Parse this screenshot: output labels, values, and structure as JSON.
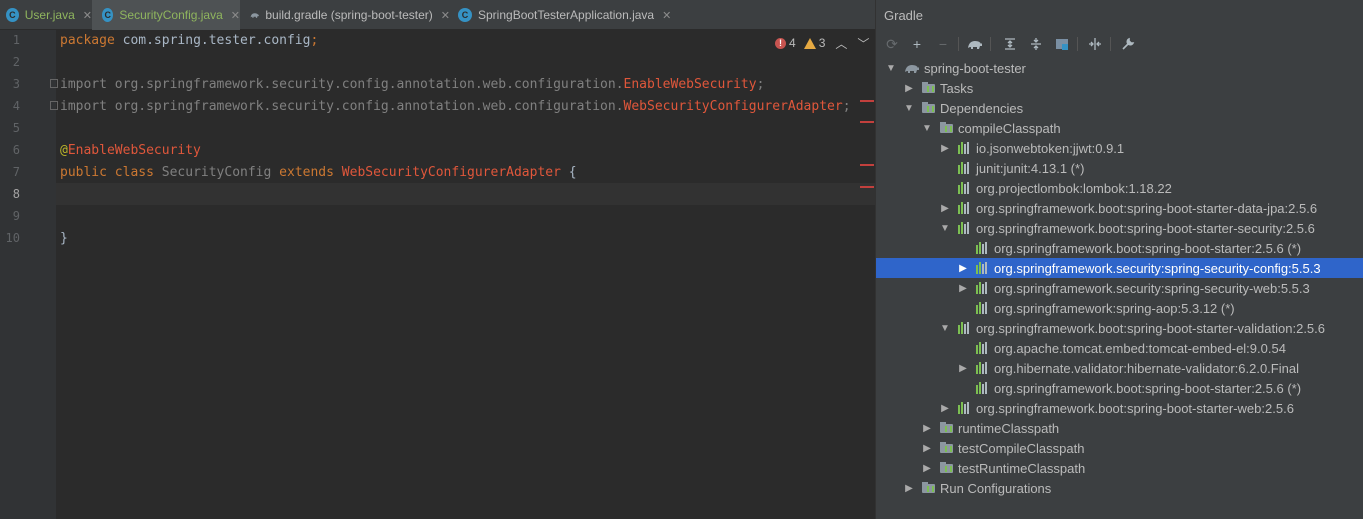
{
  "tabs": [
    {
      "label": "User.java",
      "icon": "java-class-icon"
    },
    {
      "label": "SecurityConfig.java",
      "icon": "java-class-icon",
      "active": true
    },
    {
      "label": "build.gradle (spring-boot-tester)",
      "icon": "gradle-elephant-icon"
    },
    {
      "label": "SpringBootTesterApplication.java",
      "icon": "spring-app-icon"
    }
  ],
  "editor": {
    "line_numbers": [
      "1",
      "2",
      "3",
      "4",
      "5",
      "6",
      "7",
      "8",
      "9",
      "10"
    ],
    "current_line": "8",
    "inspections": {
      "errors": "4",
      "warnings": "3"
    },
    "code": {
      "l1_kw": "package",
      "l1_rest": " com.spring.tester.config",
      "l1_semi": ";",
      "l3_kw": "import",
      "l3_pkg": " org.springframework.security.config.annotation.web.configuration.",
      "l3_cls": "EnableWebSecurity",
      "l3_semi": ";",
      "l4_kw": "import",
      "l4_pkg": " org.springframework.security.config.annotation.web.configuration.",
      "l4_cls": "WebSecurityConfigurerAdapter",
      "l4_semi": ";",
      "l6_at": "@",
      "l6_ann": "EnableWebSecurity",
      "l7_kw1": "public",
      "l7_kw2": "class",
      "l7_name": "SecurityConfig",
      "l7_kw3": "extends",
      "l7_parent": "WebSecurityConfigurerAdapter",
      "l7_brace": " {",
      "l10_brace": "}"
    }
  },
  "gradle": {
    "title": "Gradle",
    "toolbar": [
      "reload-icon",
      "add-icon",
      "remove-icon",
      "elephant-icon",
      "expand-all-icon",
      "collapse-all-icon",
      "group-modules-icon",
      "toggle-offline-icon",
      "settings-wrench-icon"
    ],
    "tree": [
      {
        "label": "spring-boot-tester",
        "indent": 0,
        "arrow": "down",
        "icon": "project"
      },
      {
        "label": "Tasks",
        "indent": 1,
        "arrow": "right",
        "icon": "folder"
      },
      {
        "label": "Dependencies",
        "indent": 1,
        "arrow": "down",
        "icon": "folder"
      },
      {
        "label": "compileClasspath",
        "indent": 2,
        "arrow": "down",
        "icon": "folder"
      },
      {
        "label": "io.jsonwebtoken:jjwt:0.9.1",
        "indent": 3,
        "arrow": "right",
        "icon": "dep"
      },
      {
        "label": "junit:junit:4.13.1 (*)",
        "indent": 3,
        "arrow": "",
        "icon": "dep"
      },
      {
        "label": "org.projectlombok:lombok:1.18.22",
        "indent": 3,
        "arrow": "",
        "icon": "dep"
      },
      {
        "label": "org.springframework.boot:spring-boot-starter-data-jpa:2.5.6",
        "indent": 3,
        "arrow": "right",
        "icon": "dep"
      },
      {
        "label": "org.springframework.boot:spring-boot-starter-security:2.5.6",
        "indent": 3,
        "arrow": "down",
        "icon": "dep"
      },
      {
        "label": "org.springframework.boot:spring-boot-starter:2.5.6 (*)",
        "indent": 4,
        "arrow": "",
        "icon": "dep"
      },
      {
        "label": "org.springframework.security:spring-security-config:5.5.3",
        "indent": 4,
        "arrow": "right",
        "icon": "dep",
        "selected": true
      },
      {
        "label": "org.springframework.security:spring-security-web:5.5.3",
        "indent": 4,
        "arrow": "right",
        "icon": "dep"
      },
      {
        "label": "org.springframework:spring-aop:5.3.12 (*)",
        "indent": 4,
        "arrow": "",
        "icon": "dep"
      },
      {
        "label": "org.springframework.boot:spring-boot-starter-validation:2.5.6",
        "indent": 3,
        "arrow": "down",
        "icon": "dep"
      },
      {
        "label": "org.apache.tomcat.embed:tomcat-embed-el:9.0.54",
        "indent": 4,
        "arrow": "",
        "icon": "dep"
      },
      {
        "label": "org.hibernate.validator:hibernate-validator:6.2.0.Final",
        "indent": 4,
        "arrow": "right",
        "icon": "dep"
      },
      {
        "label": "org.springframework.boot:spring-boot-starter:2.5.6 (*)",
        "indent": 4,
        "arrow": "",
        "icon": "dep"
      },
      {
        "label": "org.springframework.boot:spring-boot-starter-web:2.5.6",
        "indent": 3,
        "arrow": "right",
        "icon": "dep"
      },
      {
        "label": "runtimeClasspath",
        "indent": 2,
        "arrow": "right",
        "icon": "folder"
      },
      {
        "label": "testCompileClasspath",
        "indent": 2,
        "arrow": "right",
        "icon": "folder"
      },
      {
        "label": "testRuntimeClasspath",
        "indent": 2,
        "arrow": "right",
        "icon": "folder"
      },
      {
        "label": "Run Configurations",
        "indent": 1,
        "arrow": "right",
        "icon": "folder"
      }
    ]
  },
  "colors": {
    "editor_bg": "#2b2b2b",
    "keyword": "#cc7832",
    "annotation": "#bbb529",
    "error": "#e0573b",
    "selection": "#2f65ca",
    "panel_bg": "#3c3f41"
  }
}
